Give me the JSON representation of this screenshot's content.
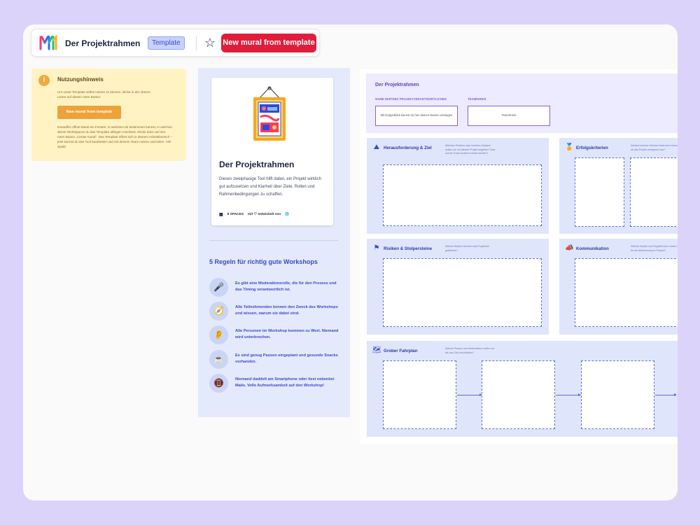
{
  "toolbar": {
    "title": "Der Projektrahmen",
    "badge": "Template",
    "star_icon": "star-icon",
    "cta": "New mural from template"
  },
  "notice": {
    "icon_text": "i",
    "title": "Nutzungshinweis",
    "text1": "Um unser Template selbst nutzen zu können, klicke in der oberen Leiste auf diesen roten Button:",
    "button": "New mural from template",
    "text2": "Daraufhin öffnet Mural ein Fenster, in welchem du bestimmen kannst, in welchen deiner Workspaces du das Template ablegen möchtest. Klicke dann auf den roten Button „Create mural\". Das Template öffnet sich in deinem Arbeitsbereich – jetzt kannst du das Tool bearbeiten und mit deinem Team nutzen und teilen. Viel Spaß!"
  },
  "card": {
    "title": "Der Projektrahmen",
    "description": "Dieses zweiphasige Tool hilft dabei, ein Projekt wirklich gut aufzusetzen und Klarheit über Ziele, Rollen und Rahmenbedingungen zu schaffen.",
    "spaces": "9 SPACES",
    "made_by": "mit ♡ entwickelt von"
  },
  "rules": {
    "title": "5 Regeln für richtig gute Workshops",
    "items": [
      {
        "icon": "microphone-icon",
        "glyph": "🎤",
        "text": "Es gibt eine Moderationsrolle, die für den Prozess und das Timing verantwortlich ist."
      },
      {
        "icon": "compass-icon",
        "glyph": "🧭",
        "text": "Alle Teilnehmenden kennen den Zweck des Workshops und wissen, warum sie dabei sind."
      },
      {
        "icon": "ear-icon",
        "glyph": "👂",
        "text": "Alle Personen im Workshop kommen zu Wort. Niemand wird unterbrochen."
      },
      {
        "icon": "coffee-icon",
        "glyph": "☕",
        "text": "Es sind genug Pausen eingeplant und gesunde Snacks vorhanden."
      },
      {
        "icon": "no-phone-icon",
        "glyph": "📵",
        "text": "Niemand daddelt am Smartphone oder liest nebenbei Mails. Volle Aufmerksamkeit auf den Workshop!"
      }
    ]
  },
  "board": {
    "title": "Der Projektrahmen",
    "label_name": "NAME DER*DES PROJEKTVERANTWORTLICHEN",
    "label_team": "TEAM/KREIS",
    "box_name": "Mit Doppelklick kannst du hier deinen Namen eintragen",
    "box_team": "Team/Kreis",
    "panels": {
      "challenge": {
        "title": "Herausforderung & Ziel",
        "icon": "mountain-flag-icon",
        "hint": "Welches Problem oder welchen Zustand wollen wir mit diesem Projekt angehen? Was soll am Ende konkret erreicht werden?"
      },
      "success": {
        "title": "Erfolgskriterien",
        "icon": "medal-icon",
        "hint": "Anhand welcher Kriterien lässt sich erkennen, ob das Projekt erfolgreich war?"
      },
      "risks": {
        "title": "Risiken & Stolpersteine",
        "icon": "hurdle-icon",
        "hint": "Welche Risiken könnten das Projektziel gefährden?"
      },
      "communication": {
        "title": "Kommunikation",
        "icon": "megaphone-icon",
        "hint": "Welche Kanäle und Regeltermine nutzen wir für die Abstimmung im Projekt?"
      },
      "plan": {
        "title": "Grober Fahrplan",
        "icon": "map-icon",
        "hint": "Welche Phasen und Meilensteine wollen wir bis zum Ziel durchlaufen?"
      }
    }
  }
}
